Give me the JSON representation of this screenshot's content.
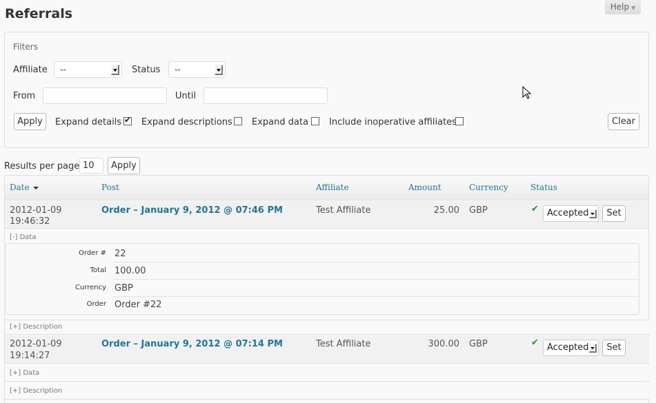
{
  "page": {
    "title": "Referrals",
    "help_label": "Help"
  },
  "filters": {
    "title": "Filters",
    "affiliate_label": "Affiliate",
    "affiliate_value": "--",
    "status_label": "Status",
    "status_value": "--",
    "from_label": "From",
    "from_value": "",
    "until_label": "Until",
    "until_value": "",
    "apply_label": "Apply",
    "clear_label": "Clear",
    "checkboxes": [
      {
        "label": "Expand details",
        "checked": true
      },
      {
        "label": "Expand descriptions",
        "checked": false
      },
      {
        "label": "Expand data",
        "checked": false
      },
      {
        "label": "Include inoperative affiliates",
        "checked": false
      }
    ]
  },
  "pagination": {
    "label": "Results per page",
    "value": "10",
    "apply_label": "Apply"
  },
  "table": {
    "columns": [
      "Date",
      "Post",
      "Affiliate",
      "Amount",
      "Currency",
      "Status"
    ],
    "rows": [
      {
        "date": "2012-01-09",
        "time": "19:46:32",
        "post": "Order – January 9, 2012 @ 07:46 PM",
        "affiliate": "Test Affiliate",
        "amount": "25.00",
        "currency": "GBP",
        "status": "Accepted",
        "set_label": "Set",
        "data_toggle": "[-] Data",
        "description_toggle": "[+] Description",
        "data": [
          {
            "key": "Order #",
            "value": "22"
          },
          {
            "key": "Total",
            "value": "100.00"
          },
          {
            "key": "Currency",
            "value": "GBP"
          },
          {
            "key": "Order",
            "value": "Order #22"
          }
        ]
      },
      {
        "date": "2012-01-09",
        "time": "19:14:27",
        "post": "Order – January 9, 2012 @ 07:14 PM",
        "affiliate": "Test Affiliate",
        "amount": "300.00",
        "currency": "GBP",
        "status": "Accepted",
        "set_label": "Set",
        "data_toggle": "[+] Data",
        "description_toggle": "[+] Description"
      }
    ]
  },
  "colors": {
    "link": "#21759b",
    "accepted": "#1a9c1a"
  }
}
